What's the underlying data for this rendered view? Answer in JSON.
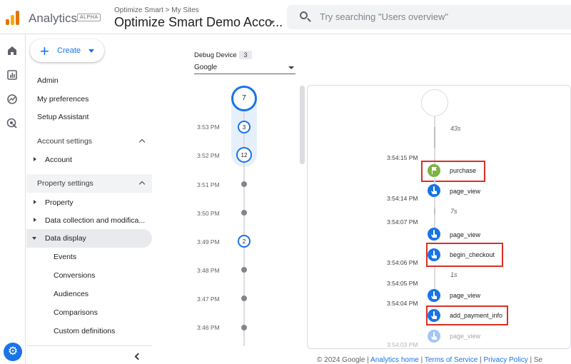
{
  "header": {
    "app_name": "Analytics",
    "badge": "ALPHA",
    "breadcrumb": "Optimize Smart > My Sites",
    "account_name": "Optimize Smart Demo Acco...",
    "search_placeholder": "Try searching \"Users overview\""
  },
  "rail": {
    "icons": [
      "home-icon",
      "reports-icon",
      "explore-icon",
      "advertising-icon"
    ],
    "settings_icon": "gear-icon"
  },
  "nav": {
    "create_label": "Create",
    "top_items": [
      "Admin",
      "My preferences",
      "Setup Assistant"
    ],
    "account_settings": "Account settings",
    "account": "Account",
    "property_settings": "Property settings",
    "property": "Property",
    "data_collection": "Data collection and modifica...",
    "data_display": "Data display",
    "sub_items": [
      "Events",
      "Conversions",
      "Audiences",
      "Comparisons",
      "Custom definitions"
    ]
  },
  "debug": {
    "label": "Debug Device",
    "count": "3",
    "device": "Google",
    "top_count": "7",
    "minutes": [
      {
        "time": "3:53 PM",
        "count": "3"
      },
      {
        "time": "3:52 PM",
        "count": "12"
      },
      {
        "time": "3:51 PM",
        "count": ""
      },
      {
        "time": "3:50 PM",
        "count": ""
      },
      {
        "time": "3:49 PM",
        "count": "2"
      },
      {
        "time": "3:48 PM",
        "count": ""
      },
      {
        "time": "3:47 PM",
        "count": ""
      },
      {
        "time": "3:46 PM",
        "count": ""
      }
    ]
  },
  "events": {
    "gap_labels": [
      "43s",
      "7s",
      "1s"
    ],
    "times": [
      "3:54:15 PM",
      "3:54:14 PM",
      "3:54:07 PM",
      "3:54:06 PM",
      "3:54:05 PM",
      "3:54:04 PM",
      "3:54:03 PM"
    ],
    "items": [
      {
        "name": "purchase",
        "highlighted": true,
        "icon": "flag-icon",
        "color": "#7cb342"
      },
      {
        "name": "page_view",
        "highlighted": false,
        "icon": "touch-icon",
        "color": "#1a73e8"
      },
      {
        "name": "page_view",
        "highlighted": false,
        "icon": "touch-icon",
        "color": "#1a73e8"
      },
      {
        "name": "begin_checkout",
        "highlighted": true,
        "icon": "touch-icon",
        "color": "#1a73e8"
      },
      {
        "name": "page_view",
        "highlighted": false,
        "icon": "touch-icon",
        "color": "#1a73e8"
      },
      {
        "name": "add_payment_info",
        "highlighted": true,
        "icon": "touch-icon",
        "color": "#1a73e8"
      },
      {
        "name": "page_view",
        "highlighted": false,
        "icon": "touch-icon",
        "color": "#1a73e8"
      }
    ]
  },
  "footer": {
    "copyright": "© 2024 Google |",
    "links": [
      "Analytics home",
      "Terms of Service",
      "Privacy Policy"
    ],
    "tail": "Se"
  },
  "colors": {
    "accent": "#1a73e8",
    "highlight_border": "#d93025",
    "purchase_green": "#7cb342"
  }
}
